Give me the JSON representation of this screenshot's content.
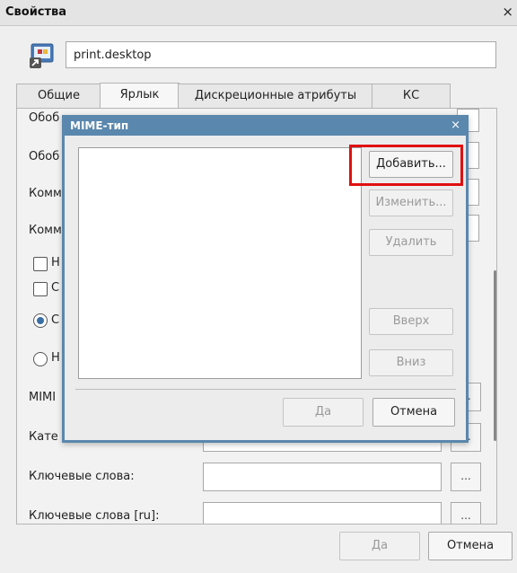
{
  "window": {
    "title": "Свойства",
    "close_glyph": "×"
  },
  "header": {
    "file_name": "print.desktop",
    "file_icon": "desktop-file-icon"
  },
  "tabs": [
    {
      "label": "Общие"
    },
    {
      "label": "Ярлык"
    },
    {
      "label": "Дискреционные атрибуты"
    },
    {
      "label": "КС"
    }
  ],
  "fields": {
    "obob1": "Обоб",
    "obob2": "Обоб",
    "komm1": "Комм",
    "komm2": "Комм",
    "chk1": "Н",
    "chk2": "С",
    "radio1": "С",
    "radio2": "Н",
    "mime": "MIMI",
    "category": "Кате",
    "keywords": "Ключевые слова:",
    "keywords_ru": "Ключевые слова [ru]:"
  },
  "dots_label": "...",
  "footer": {
    "ok": "Да",
    "cancel": "Отмена"
  },
  "mime_dialog": {
    "title": "MIME-тип",
    "close_glyph": "×",
    "add": "Добавить...",
    "edit": "Изменить...",
    "delete": "Удалить",
    "up": "Вверх",
    "down": "Вниз",
    "ok": "Да",
    "cancel": "Отмена"
  },
  "colors": {
    "dialog_accent": "#5a87ad",
    "highlight": "#e01010"
  }
}
